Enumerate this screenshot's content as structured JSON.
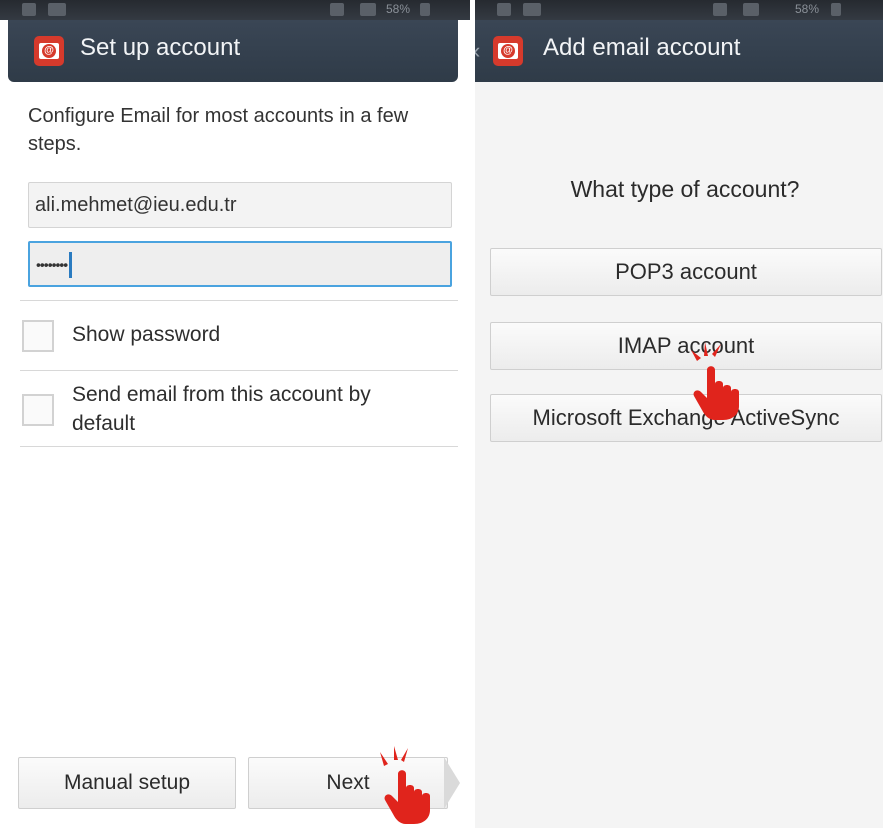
{
  "left": {
    "title": "Set up account",
    "intro": "Configure Email for most accounts in a few steps.",
    "email_value": "ali.mehmet@ieu.edu.tr",
    "password_mask": "••••••••",
    "show_password_label": "Show password",
    "send_default_label": "Send email from this account by default",
    "manual_setup_label": "Manual setup",
    "next_label": "Next"
  },
  "right": {
    "title": "Add email account",
    "question": "What type of account?",
    "buttons": [
      "POP3 account",
      "IMAP account",
      "Microsoft Exchange ActiveSync"
    ]
  },
  "status": {
    "left_battery": "58%",
    "right_battery": "58%"
  },
  "colors": {
    "action_bar": "#33404d",
    "app_icon": "#d63a2c",
    "focus_border": "#4aa3df",
    "hand_pointer": "#e0241c"
  }
}
